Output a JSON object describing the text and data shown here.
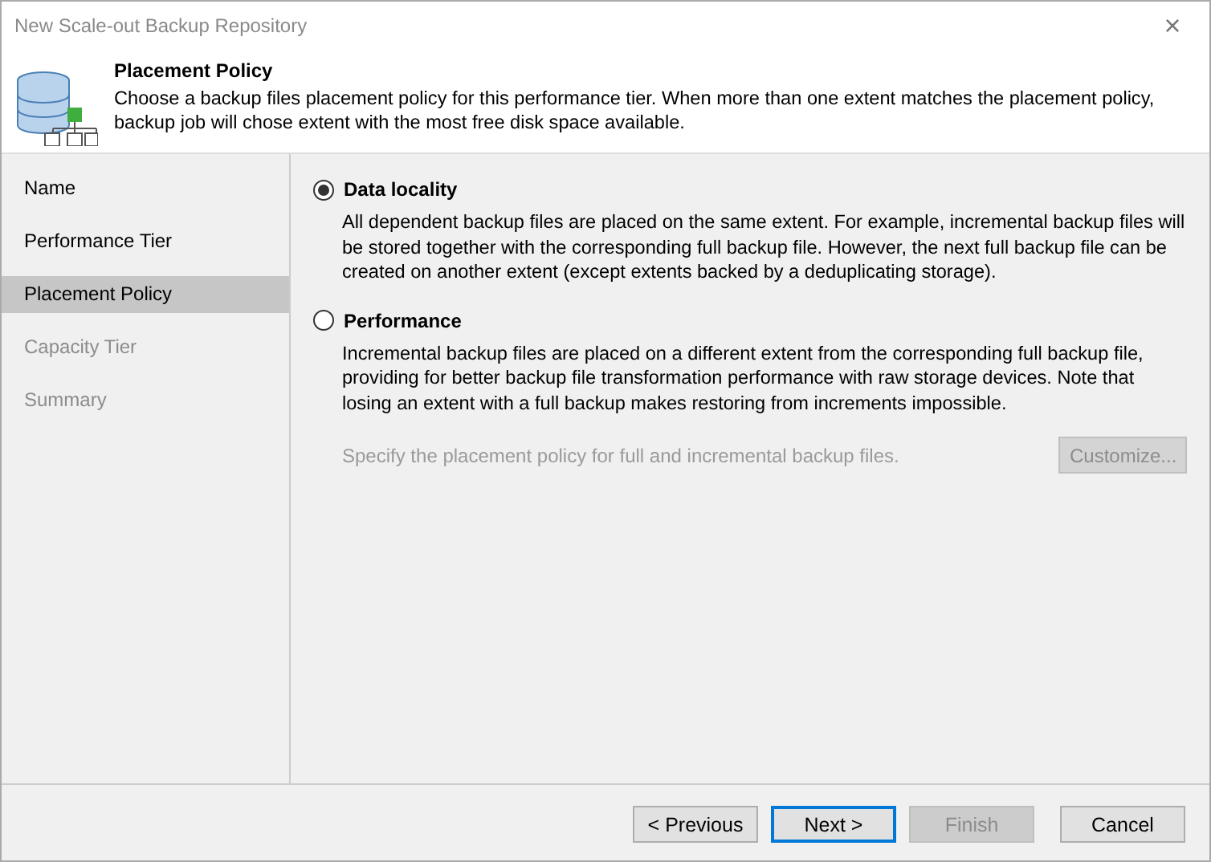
{
  "window": {
    "title": "New Scale-out Backup Repository",
    "close": "×"
  },
  "header": {
    "title": "Placement Policy",
    "description": "Choose a backup files placement policy for this performance tier. When more than one extent matches the placement policy, backup job will chose extent with the most free disk space available."
  },
  "steps": [
    {
      "label": "Name",
      "selected": false,
      "disabled": false
    },
    {
      "label": "Performance Tier",
      "selected": false,
      "disabled": false
    },
    {
      "label": "Placement Policy",
      "selected": true,
      "disabled": false
    },
    {
      "label": "Capacity Tier",
      "selected": false,
      "disabled": true
    },
    {
      "label": "Summary",
      "selected": false,
      "disabled": true
    }
  ],
  "options": [
    {
      "label": "Data locality",
      "selected": true,
      "description": "All dependent backup files are placed on the same extent. For example, incremental backup files will be stored together with the corresponding full backup file. However, the next full backup file can be created on another extent (except extents backed by a deduplicating storage)."
    },
    {
      "label": "Performance",
      "selected": false,
      "description": "Incremental backup files are placed on a different extent from the corresponding full backup file, providing for better backup file transformation performance with raw storage devices. Note that losing an extent with a full backup makes restoring from increments impossible."
    }
  ],
  "policy": {
    "text": "Specify the placement policy for full and incremental backup files.",
    "button": "Customize...",
    "disabled": true
  },
  "buttons": [
    {
      "label": "< Previous",
      "default": false,
      "disabled": false
    },
    {
      "label": "Next >",
      "default": true,
      "disabled": false
    },
    {
      "label": "Finish",
      "default": false,
      "disabled": true
    },
    {
      "label": "Cancel",
      "default": false,
      "disabled": false
    }
  ]
}
